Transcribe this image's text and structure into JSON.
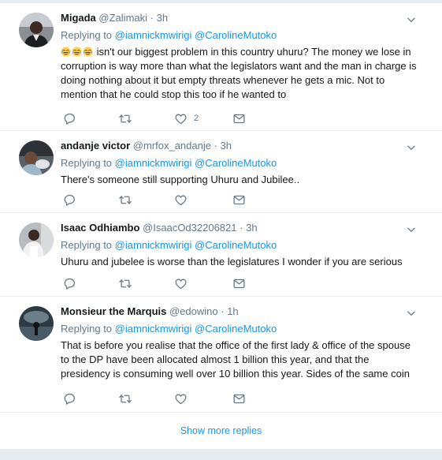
{
  "tweets": [
    {
      "name": "Migada",
      "handle": "@Zalimaki",
      "time": "3h",
      "replying_label": "Replying to",
      "mentions": [
        "@iamnickmwirigi",
        "@CarolineMutoko"
      ],
      "emojis": [
        "face-with-tears-of-joy",
        "face-with-tears-of-joy",
        "face-with-tears-of-joy"
      ],
      "text": " isn't our biggest problem in this country uhuru? The money we lose in corruption is way more than what the legislators want and the man in charge is doing nothing about it but empty threats whenever he gets a mic. Not to mention that he could stop this too if he wanted to",
      "like_count": "2"
    },
    {
      "name": "andanje victor",
      "handle": "@mrfox_andanje",
      "time": "3h",
      "replying_label": "Replying to",
      "mentions": [
        "@iamnickmwirigi",
        "@CarolineMutoko"
      ],
      "text": "There's someone still supporting Uhuru and Jubilee.."
    },
    {
      "name": "Isaac Odhiambo",
      "handle": "@IsaacOd32206821",
      "time": "3h",
      "replying_label": "Replying to",
      "mentions": [
        "@iamnickmwirigi",
        "@CarolineMutoko"
      ],
      "text": "Uhuru and jubelee is  worse than the legislatures I wonder if you are serious"
    },
    {
      "name": "Monsieur the Marquis",
      "handle": "@edowino",
      "time": "1h",
      "replying_label": "Replying to",
      "mentions": [
        "@iamnickmwirigi",
        "@CarolineMutoko"
      ],
      "text": "That is before you realise that the office of the first lady & office of the spouse to the DP have been allocated almost 1 billion this year, and that the presidency is consuming well over 10 billion this year. Sides of the same coin"
    }
  ],
  "separator": "·",
  "show_more_label": "Show more replies",
  "icons": [
    "reply-icon",
    "retweet-icon",
    "like-icon",
    "direct-message-icon",
    "chevron-down-icon"
  ],
  "colors": {
    "background": "#e6ecf0",
    "card": "#ffffff",
    "link": "#1b95e0",
    "secondary_text": "#657786",
    "primary_text": "#14171a"
  }
}
